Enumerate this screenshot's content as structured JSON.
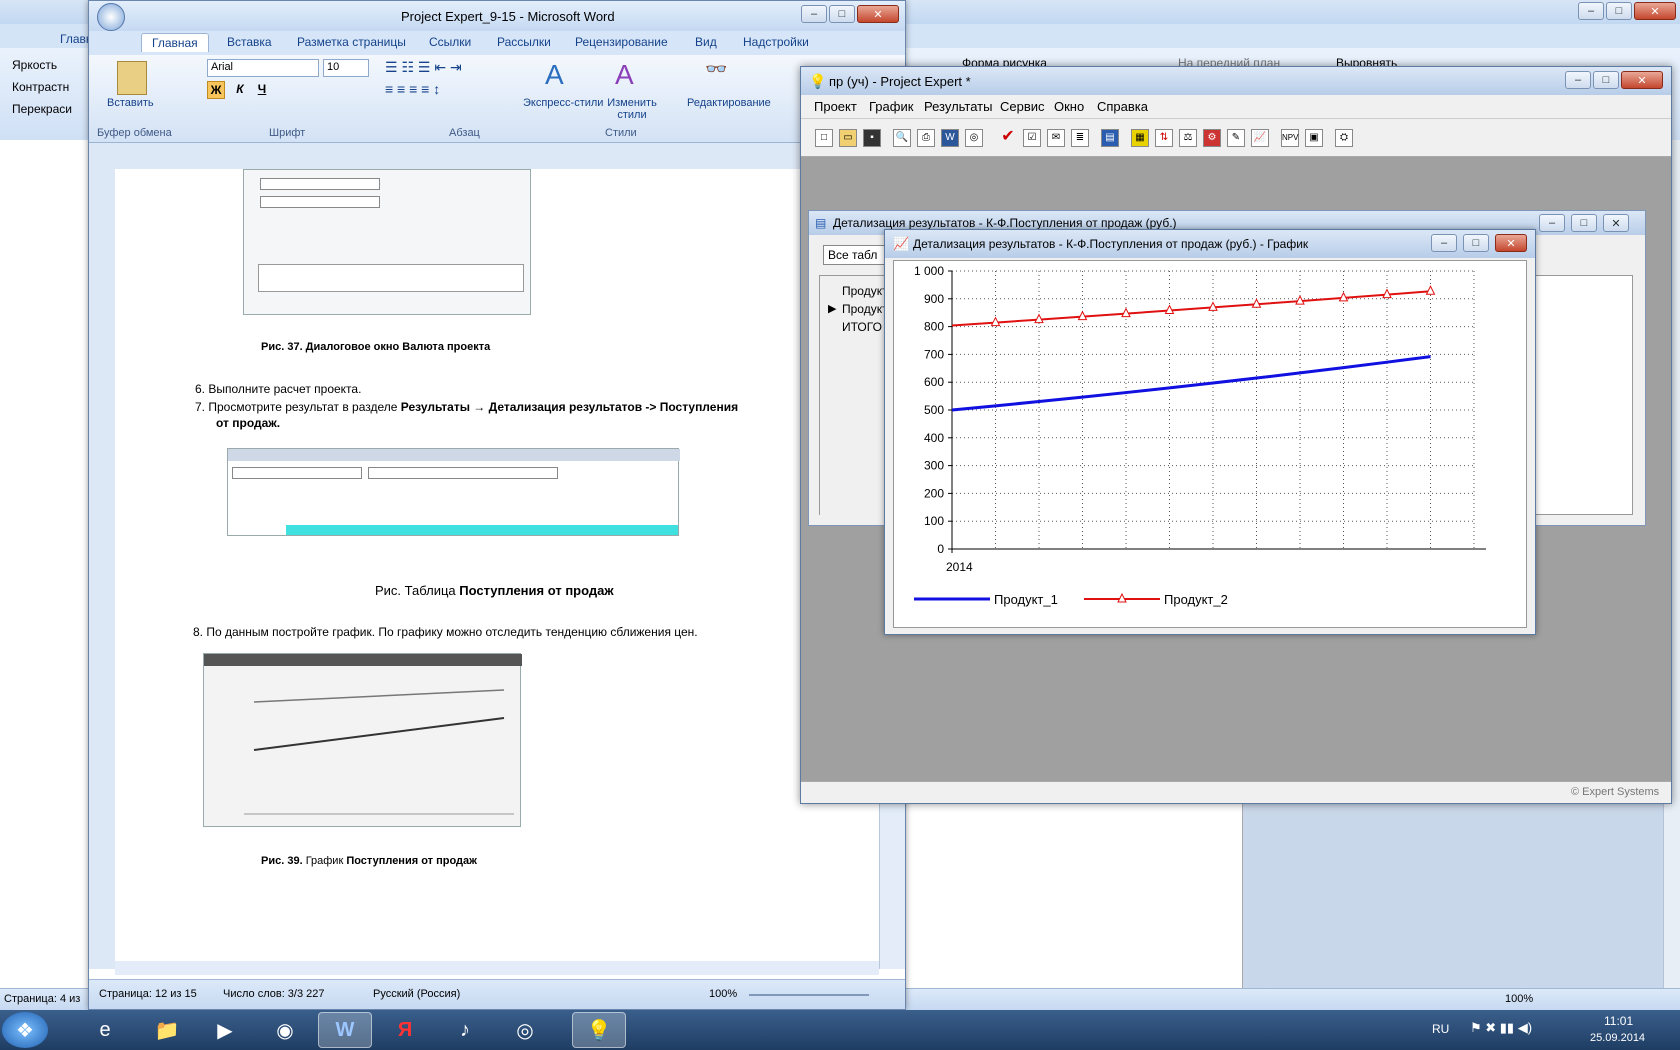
{
  "background_word": {
    "tabs": [
      "Главна"
    ],
    "ribbon_left": [
      "Яркость",
      "Контрастн",
      "Перекраси"
    ],
    "ribbon_right": [
      "Форма рисунка",
      "На передний план",
      "Выровнять"
    ],
    "status_left": "Страница: 4 из",
    "zoom": "100%"
  },
  "word": {
    "title": "Project Expert_9-15 - Microsoft Word",
    "tabs": [
      "Главная",
      "Вставка",
      "Разметка страницы",
      "Ссылки",
      "Рассылки",
      "Рецензирование",
      "Вид",
      "Надстройки"
    ],
    "groups": [
      "Буфер обмена",
      "Шрифт",
      "Абзац",
      "Стили",
      "Редактирование"
    ],
    "buttons": {
      "paste": "Вставить",
      "express_styles": "Экспресс-стили",
      "change_styles": "Изменить стили",
      "editing": "Редактирование"
    },
    "font_name": "Arial",
    "font_size": "10",
    "doc": {
      "fig37_caption": "Рис. 37. Диалоговое окно Валюта проекта",
      "item6": "6.   Выполните расчет проекта.",
      "item7_a": "7.   Просмотрите результат в разделе ",
      "item7_b": "Результаты  → Детализация  результатов  -> Поступления",
      "item7_c": "от продаж.",
      "table_caption_a": "Рис. Таблица ",
      "table_caption_b": "Поступления  от продаж",
      "item8": "8. По данным постройте график. По графику можно отследить тенденцию  сближения цен.",
      "fig39_caption_a": "Рис. 39. ",
      "fig39_caption_b": "График ",
      "fig39_caption_c": "Поступления от продаж"
    },
    "status": {
      "page": "Страница: 12 из 15",
      "words": "Число слов: 3/3 227",
      "lang": "Русский (Россия)",
      "zoom": "100%"
    }
  },
  "project_expert": {
    "title": "пр (уч) - Project Expert *",
    "menu": [
      "Проект",
      "График",
      "Результаты",
      "Сервис",
      "Окно",
      "Справка"
    ],
    "status": "© Expert Systems",
    "detail_window": {
      "title": "Детализация результатов - К-Ф.Поступления от продаж (руб.)",
      "table_selector": "Все табл",
      "rows": [
        "Продукт_",
        "Продукт_",
        "ИТОГО"
      ]
    },
    "graph_window": {
      "title": "Детализация результатов - К-Ф.Поступления от продаж (руб.) - График"
    }
  },
  "chart_data": {
    "type": "line",
    "title": "",
    "xlabel": "",
    "ylabel": "",
    "x_tick_label": "2014",
    "x": [
      "1.2014",
      "2.2014",
      "3.2014",
      "4.2014",
      "5.2014",
      "6.2014",
      "7.2014",
      "8.2014",
      "9.2014",
      "10.2014",
      "11.2014",
      "12.2014"
    ],
    "ylim": [
      0,
      1000
    ],
    "yticks": [
      "0",
      "100",
      "200",
      "300",
      "400",
      "500",
      "600",
      "700",
      "800",
      "900",
      "1 000"
    ],
    "grid": true,
    "legend": "bottom",
    "series": [
      {
        "name": "Продукт_1",
        "color": "#1010e0",
        "values": [
          500,
          515,
          530.45,
          546.36,
          562.75,
          579.64,
          597.03,
          614.94,
          633.39,
          652.39,
          671.96,
          692.12
        ]
      },
      {
        "name": "Продукт_2",
        "color": "#e01010",
        "values": [
          804,
          814.48,
          825.09,
          835.84,
          846.73,
          857.76,
          868.94,
          880.26,
          891.73,
          903.35,
          915.12,
          927.05
        ]
      }
    ]
  },
  "taskbar": {
    "lang": "RU",
    "time": "11:01",
    "date": "25.09.2014"
  }
}
